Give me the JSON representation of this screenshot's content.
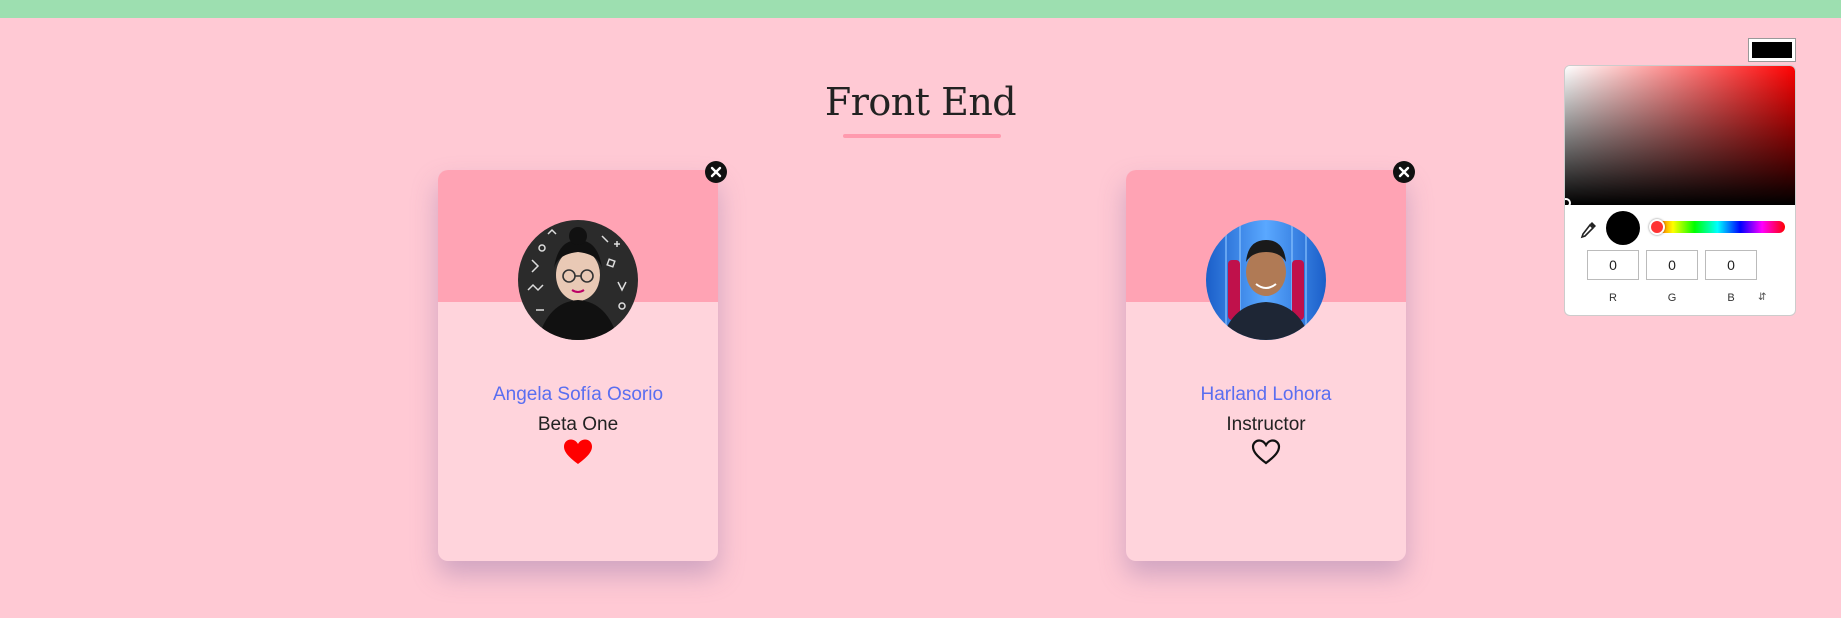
{
  "page": {
    "title": "Front End"
  },
  "cards": [
    {
      "name": "Angela Sofía Osorio",
      "role": "Beta One",
      "liked": true,
      "avatar_icon": "woman-with-glasses-photo"
    },
    {
      "name": "Harland Lohora",
      "role": "Instructor",
      "liked": false,
      "avatar_icon": "man-portrait-photo"
    }
  ],
  "color_picker": {
    "r": "0",
    "g": "0",
    "b": "0",
    "r_label": "R",
    "g_label": "G",
    "b_label": "B",
    "toggle_icon": "chevron-updown-icon",
    "selected_color": "#000000",
    "hue_color": "#ff0000"
  },
  "colors": {
    "background": "#ffc9d4",
    "top_bar": "#9ddfb0",
    "card_band": "#ffa3b4",
    "card_body": "#ffd4dc",
    "name_text": "#5a6ef0",
    "heart_liked": "#ff0000"
  }
}
